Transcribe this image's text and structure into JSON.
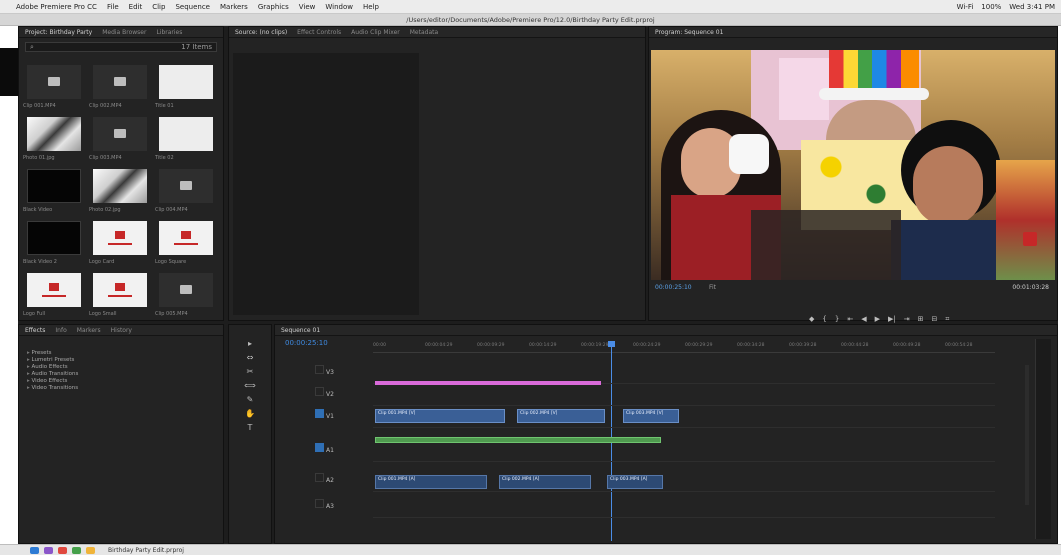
{
  "menubar": {
    "app": "Adobe Premiere Pro CC",
    "items": [
      "File",
      "Edit",
      "Clip",
      "Sequence",
      "Markers",
      "Graphics",
      "View",
      "Window",
      "Help"
    ],
    "tray": [
      "Wi‑Fi",
      "100%",
      "Wed 3:41 PM"
    ]
  },
  "titlebar": {
    "title": "/Users/editor/Documents/Adobe/Premiere Pro/12.0/Birthday Party Edit.prproj"
  },
  "project_panel": {
    "tabs": [
      "Project: Birthday Party",
      "Media Browser",
      "Libraries"
    ],
    "search_placeholder": "",
    "items_count": "17 Items",
    "items": [
      {
        "name": "Clip 001.MP4",
        "kind": "gray"
      },
      {
        "name": "Clip 002.MP4",
        "kind": "gray"
      },
      {
        "name": "Title 01",
        "kind": "white"
      },
      {
        "name": "Photo 01.jpg",
        "kind": "photo"
      },
      {
        "name": "Clip 003.MP4",
        "kind": "gray"
      },
      {
        "name": "Title 02",
        "kind": "white"
      },
      {
        "name": "Black Video",
        "kind": "black"
      },
      {
        "name": "Photo 02.jpg",
        "kind": "photo"
      },
      {
        "name": "Clip 004.MP4",
        "kind": "gray"
      },
      {
        "name": "Black Video 2",
        "kind": "black"
      },
      {
        "name": "Logo Card",
        "kind": "logo"
      },
      {
        "name": "Logo Square",
        "kind": "logo"
      },
      {
        "name": "Logo Full",
        "kind": "logo"
      },
      {
        "name": "Logo Small",
        "kind": "logo"
      },
      {
        "name": "Clip 005.MP4",
        "kind": "gray"
      }
    ]
  },
  "source_panel": {
    "tabs": [
      "Source: (no clips)",
      "Effect Controls",
      "Audio Clip Mixer",
      "Metadata"
    ]
  },
  "program_monitor": {
    "tab": "Program: Sequence 01",
    "timecode_left": "00:00:25:10",
    "fit": "Fit",
    "timecode_right": "00:01:03:28",
    "controls": [
      "◆",
      "{",
      "}",
      "⇤",
      "◀",
      "▶",
      "▶|",
      "⇥",
      "⊞",
      "⊟",
      "⌗"
    ]
  },
  "effects_panel": {
    "tabs": [
      "Effects",
      "Info",
      "Markers",
      "History"
    ],
    "tree": [
      "Presets",
      "Lumetri Presets",
      "Audio Effects",
      "Audio Transitions",
      "Video Effects",
      "Video Transitions"
    ]
  },
  "tools": {
    "icons": [
      "▸",
      "⇔",
      "✂",
      "⟺",
      "✎",
      "✋",
      "T"
    ]
  },
  "timeline": {
    "tab": "Sequence 01",
    "timecode": "00:00:25:10",
    "ruler": [
      "00:00",
      "00:00:04:29",
      "00:00:09:29",
      "00:00:14:29",
      "00:00:19:29",
      "00:00:24:29",
      "00:00:29:29",
      "00:00:34:28",
      "00:00:39:28",
      "00:00:44:28",
      "00:00:49:28",
      "00:00:54:28"
    ],
    "tracks": [
      "V3",
      "V2",
      "V1",
      "A1",
      "A2",
      "A3"
    ],
    "clips": [
      {
        "label": "Clip 001.MP4 [V]"
      },
      {
        "label": "Clip 002.MP4 [V]"
      },
      {
        "label": "Clip 003.MP4 [V]"
      },
      {
        "label": "Clip 001.MP4 [A]"
      },
      {
        "label": "Clip 002.MP4 [A]"
      },
      {
        "label": "Clip 003.MP4 [A]"
      }
    ]
  },
  "dock": {
    "label": "Birthday Party Edit.prproj"
  },
  "colors": {
    "accent_blue": "#4b8de6",
    "pink_track": "#d96ad9",
    "green_clip": "#4f9a4f",
    "clip_blue": "#3a5f96"
  }
}
